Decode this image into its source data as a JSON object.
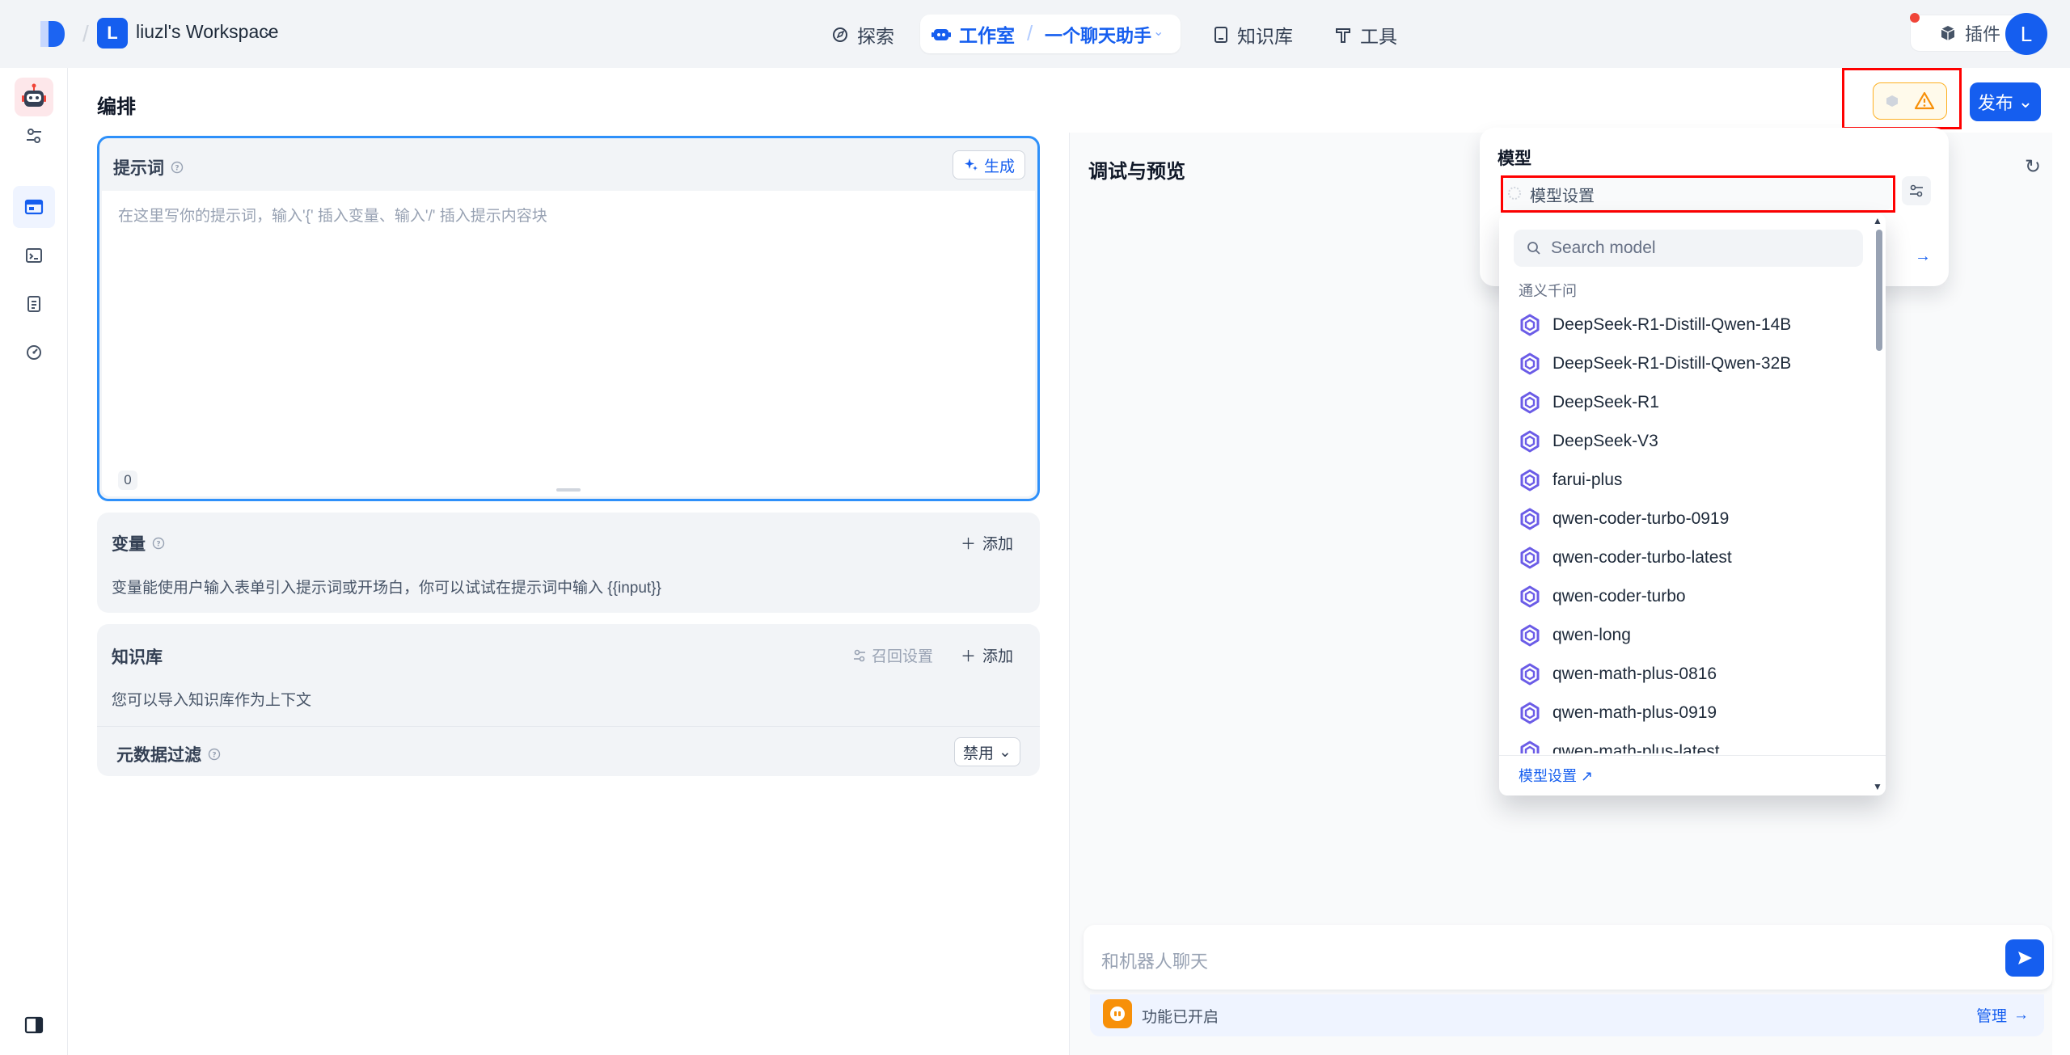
{
  "topbar": {
    "workspace_initial": "L",
    "workspace_name": "liuzl's Workspace",
    "nav": {
      "explore": "探索",
      "studio": "工作室",
      "app_name": "一个聊天助手",
      "knowledge": "知识库",
      "tools": "工具"
    },
    "plugins": "插件",
    "user_initial": "L"
  },
  "orchestrate": {
    "title": "编排",
    "publish": "发布",
    "prompt": {
      "label": "提示词",
      "generate": "生成",
      "placeholder": "在这里写你的提示词，输入'{' 插入变量、输入'/' 插入提示内容块",
      "count": "0"
    },
    "variables": {
      "label": "变量",
      "add": "添加",
      "desc": "变量能使用户输入表单引入提示词或开场白，你可以试试在提示词中输入 {{input}}"
    },
    "knowledge": {
      "label": "知识库",
      "recall": "召回设置",
      "add": "添加",
      "desc": "您可以导入知识库作为上下文",
      "metadata_filter": "元数据过滤",
      "filter_value": "禁用"
    }
  },
  "debug": {
    "title": "调试与预览",
    "chat_placeholder": "和机器人聊天",
    "feature_status": "功能已开启",
    "manage": "管理"
  },
  "model_popover": {
    "label": "模型",
    "trigger_text": "模型设置",
    "search_placeholder": "Search model",
    "provider": "通义千问",
    "models": [
      "DeepSeek-R1-Distill-Qwen-14B",
      "DeepSeek-R1-Distill-Qwen-32B",
      "DeepSeek-R1",
      "DeepSeek-V3",
      "farui-plus",
      "qwen-coder-turbo-0919",
      "qwen-coder-turbo-latest",
      "qwen-coder-turbo",
      "qwen-long",
      "qwen-math-plus-0816",
      "qwen-math-plus-0919",
      "qwen-math-plus-latest"
    ],
    "footer_link": "模型设置 ↗"
  },
  "colors": {
    "primary": "#155eef",
    "warning": "#f79009",
    "highlight_box": "#ff0000"
  }
}
